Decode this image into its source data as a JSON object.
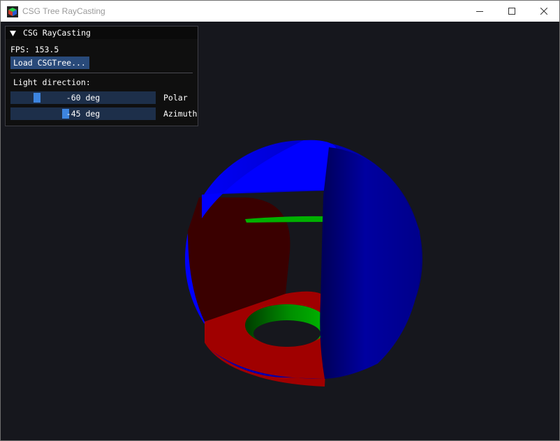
{
  "window": {
    "title": "CSG Tree RayCasting",
    "icon": "app-cube-icon",
    "controls": [
      "minimize-icon",
      "maximize-icon",
      "close-icon"
    ]
  },
  "panel": {
    "title": "CSG RayCasting",
    "fps_label": "FPS:",
    "fps_value": "153.5",
    "load_button": "Load CSGTree...",
    "light_label": "Light direction:",
    "polar": {
      "value_text": "-60 deg",
      "label": "Polar",
      "value": -60,
      "min": -90,
      "max": 90
    },
    "azimuth": {
      "value_text": "-45 deg",
      "label": "Azimuth",
      "value": -45,
      "min": -180,
      "max": 180
    }
  },
  "colors": {
    "background": "#16171d",
    "panel_bg": "#0f0f0f",
    "button": "#294a7a",
    "slider_bg": "#1d2f4a",
    "slider_grab": "#3d85e0",
    "sphere": "#0000c8",
    "red": "#b00000",
    "green": "#00b000"
  }
}
